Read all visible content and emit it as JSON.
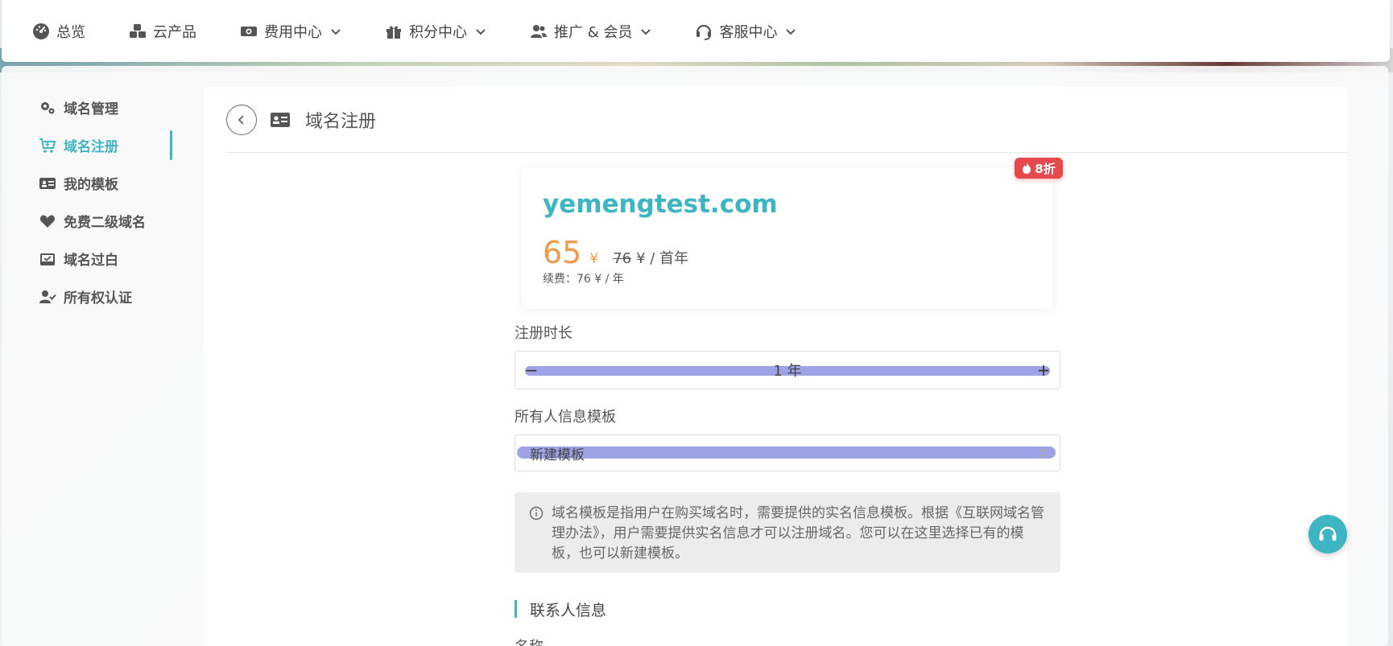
{
  "topnav": {
    "items": [
      {
        "label": "总览",
        "icon": "dashboard-icon",
        "dropdown": false
      },
      {
        "label": "云产品",
        "icon": "cubes-icon",
        "dropdown": false
      },
      {
        "label": "费用中心",
        "icon": "money-icon",
        "dropdown": true
      },
      {
        "label": "积分中心",
        "icon": "gift-icon",
        "dropdown": true
      },
      {
        "label": "推广 & 会员",
        "icon": "users-icon",
        "dropdown": true
      },
      {
        "label": "客服中心",
        "icon": "headset-icon",
        "dropdown": true
      }
    ]
  },
  "sidebar": {
    "items": [
      {
        "label": "域名管理",
        "icon": "cogs-icon",
        "active": false
      },
      {
        "label": "域名注册",
        "icon": "cart-icon",
        "active": true
      },
      {
        "label": "我的模板",
        "icon": "id-card-icon",
        "active": false
      },
      {
        "label": "免费二级域名",
        "icon": "heart-icon",
        "active": false
      },
      {
        "label": "域名过白",
        "icon": "inbox-check-icon",
        "active": false
      },
      {
        "label": "所有权认证",
        "icon": "user-check-icon",
        "active": false
      }
    ]
  },
  "header": {
    "title": "域名注册"
  },
  "domain_card": {
    "badge": "8折",
    "domain": "yemengtest.com",
    "price_now": "65",
    "currency": "¥",
    "price_old": "76",
    "price_unit": "¥ / 首年",
    "renew": "续费：76 ¥ / 年"
  },
  "form": {
    "duration_label": "注册时长",
    "duration_value": "1 年",
    "minus": "−",
    "plus": "+",
    "template_label": "所有人信息模板",
    "template_value": "新建模板",
    "notice": "域名模板是指用户在购买域名时，需要提供的实名信息模板。根据《互联网域名管理办法》，用户需要提供实名信息才可以注册域名。您可以在这里选择已有的模板，也可以新建模板。",
    "section_title": "联系人信息",
    "name_label": "名称"
  },
  "colors": {
    "accent": "#3db5c2",
    "price": "#f2994a",
    "badge": "#e5484d"
  }
}
